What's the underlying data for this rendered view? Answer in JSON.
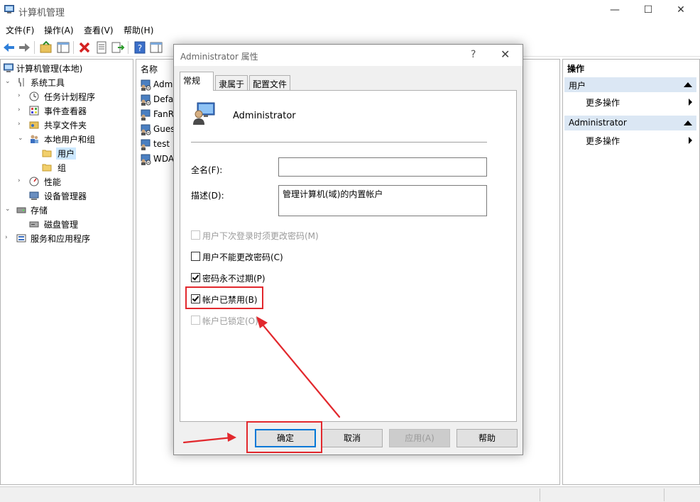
{
  "window": {
    "title": "计算机管理",
    "controls": [
      "—",
      "☐",
      "✕"
    ]
  },
  "menu": [
    "文件(F)",
    "操作(A)",
    "查看(V)",
    "帮助(H)"
  ],
  "tree": {
    "items": [
      "计算机管理(本地)",
      "系统工具",
      "任务计划程序",
      "事件查看器",
      "共享文件夹",
      "本地用户和组",
      "用户",
      "组",
      "性能",
      "设备管理器",
      "存储",
      "磁盘管理",
      "服务和应用程序"
    ]
  },
  "list": {
    "header": "名称",
    "rows": [
      "Admi",
      "Defau",
      "FanRu",
      "Gues",
      "test",
      "WDA"
    ]
  },
  "actions": {
    "header": "操作",
    "sections": [
      {
        "title": "用户",
        "item": "更多操作"
      },
      {
        "title": "Administrator",
        "item": "更多操作"
      }
    ]
  },
  "dialog": {
    "title": "Administrator 属性",
    "help": "?",
    "close": "✕",
    "tabs": [
      "常规",
      "隶属于",
      "配置文件"
    ],
    "user_name": "Administrator",
    "fullname_label": "全名(F):",
    "fullname_value": "",
    "desc_label": "描述(D):",
    "desc_value": "管理计算机(域)的内置帐户",
    "checkboxes": [
      {
        "label": "用户下次登录时须更改密码(M)",
        "checked": false,
        "disabled": true
      },
      {
        "label": "用户不能更改密码(C)",
        "checked": false,
        "disabled": false
      },
      {
        "label": "密码永不过期(P)",
        "checked": true,
        "disabled": false
      },
      {
        "label": "帐户已禁用(B)",
        "checked": true,
        "disabled": false
      },
      {
        "label": "帐户已锁定(O)",
        "checked": false,
        "disabled": true
      }
    ],
    "buttons": {
      "ok": "确定",
      "cancel": "取消",
      "apply": "应用(A)",
      "help": "帮助"
    }
  },
  "colors": {
    "annotation": "#e2282d",
    "selection": "#cce8ff",
    "action_header": "#dbe7f4"
  }
}
